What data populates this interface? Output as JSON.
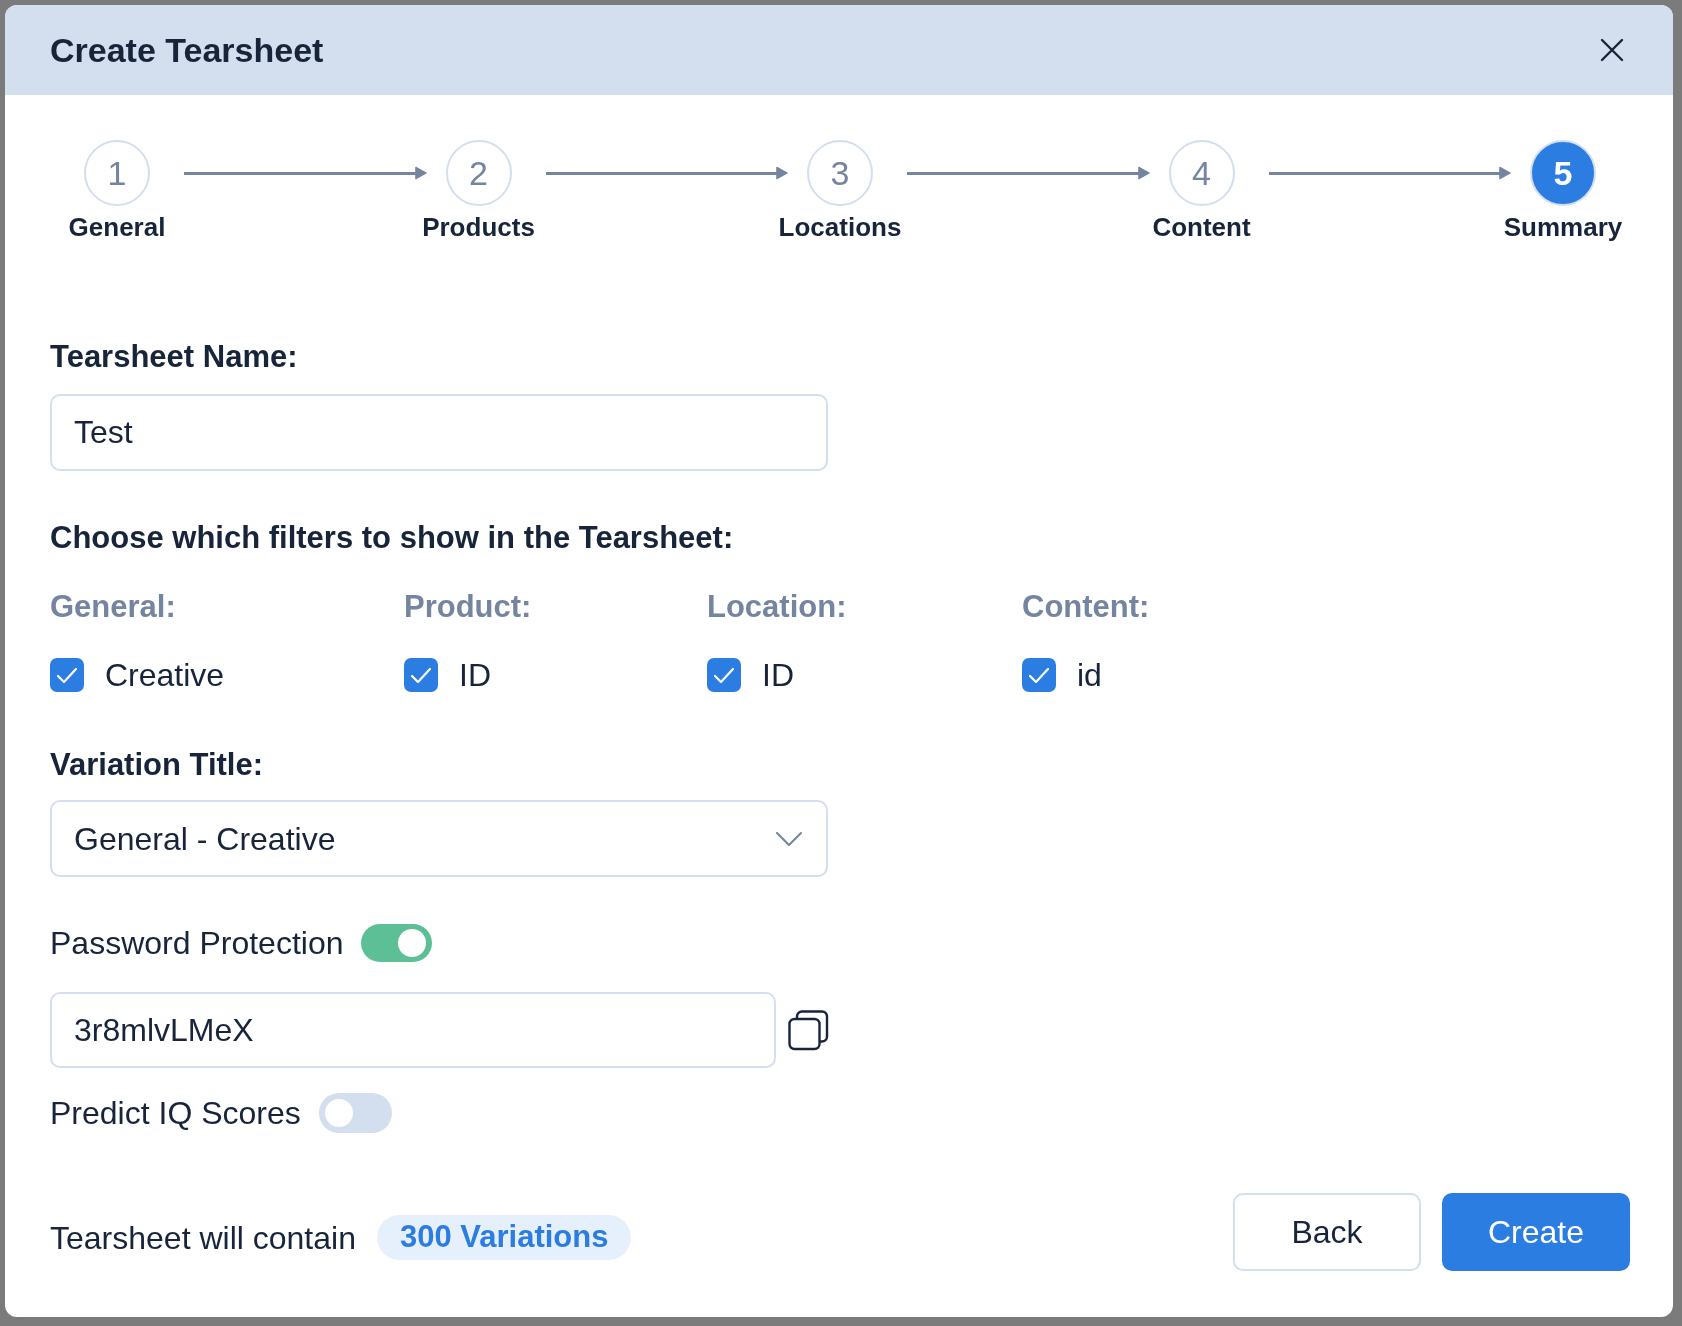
{
  "window": {
    "title": "Create Tearsheet"
  },
  "steps": [
    {
      "number": "1",
      "label": "General",
      "selected": false
    },
    {
      "number": "2",
      "label": "Products",
      "selected": false
    },
    {
      "number": "3",
      "label": "Locations",
      "selected": false
    },
    {
      "number": "4",
      "label": "Content",
      "selected": false
    },
    {
      "number": "5",
      "label": "Summary",
      "selected": true
    }
  ],
  "name_field": {
    "label": "Tearsheet Name:",
    "value": "Test"
  },
  "filters": {
    "title": "Choose which filters to show in the Tearsheet:",
    "groups": [
      {
        "heading": "General:",
        "options": [
          {
            "label": "Creative",
            "checked": true
          }
        ]
      },
      {
        "heading": "Product:",
        "options": [
          {
            "label": "ID",
            "checked": true
          }
        ]
      },
      {
        "heading": "Location:",
        "options": [
          {
            "label": "ID",
            "checked": true
          }
        ]
      },
      {
        "heading": "Content:",
        "options": [
          {
            "label": "id",
            "checked": true
          }
        ]
      }
    ]
  },
  "variation_title": {
    "label": "Variation Title:",
    "value": "General - Creative"
  },
  "password_protection": {
    "label": "Password Protection",
    "on": true,
    "value": "3r8mlvLMeX"
  },
  "predict_iq": {
    "label": "Predict IQ Scores",
    "on": false
  },
  "footer": {
    "summary_text": "Tearsheet will contain",
    "badge": "300 Variations",
    "buttons": [
      {
        "label": "Back",
        "kind": "secondary"
      },
      {
        "label": "Create",
        "kind": "primary"
      }
    ]
  }
}
